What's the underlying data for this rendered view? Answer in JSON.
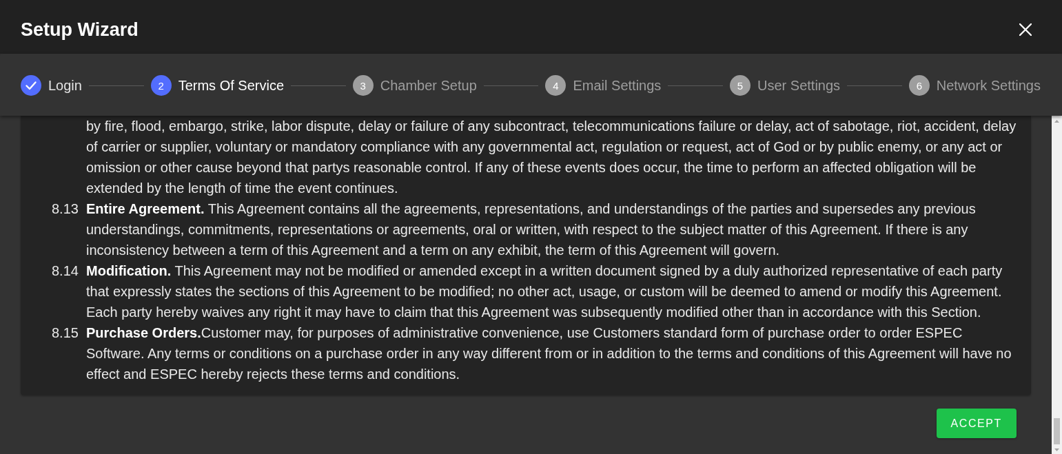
{
  "dialog": {
    "title": "Setup Wizard"
  },
  "steps": [
    {
      "kind": "done",
      "label": "Login",
      "selected": false
    },
    {
      "kind": "numbered",
      "number": "2",
      "label": "Terms Of Service",
      "selected": true
    },
    {
      "kind": "numbered",
      "number": "3",
      "label": "Chamber Setup",
      "selected": false
    },
    {
      "kind": "numbered",
      "number": "4",
      "label": "Email Settings",
      "selected": false
    },
    {
      "kind": "numbered",
      "number": "5",
      "label": "User Settings",
      "selected": false
    },
    {
      "kind": "numbered",
      "number": "6",
      "label": "Network Settings",
      "selected": false
    }
  ],
  "terms": [
    {
      "text": "by fire, flood, embargo, strike, labor dispute, delay or failure of any subcontract, telecommunications failure or delay, act of sabotage, riot, accident, delay of carrier or supplier, voluntary or mandatory compliance with any governmental act, regulation or request, act of God or by public enemy, or any act or omission or other cause beyond that partys reasonable control. If any of these events does occur, the time to perform an affected obligation will be extended by the length of time the event continues."
    },
    {
      "number": "8.13",
      "text": "**Entire Agreement.** This Agreement contains all the agreements, representations, and understandings of the parties and supersedes any previous understandings, commitments, representations or agreements, oral or written, with respect to the subject matter of this Agreement. If there is any inconsistency between a term of this Agreement and a term on any exhibit, the term of this Agreement will govern."
    },
    {
      "number": "8.14",
      "text": "**Modification.** This Agreement may not be modified or amended except in a written document signed by a duly authorized representative of each party that expressly states the sections of this Agreement to be modified; no other act, usage, or custom will be deemed to amend or modify this Agreement. Each party hereby waives any right it may have to claim that this Agreement was subsequently modified other than in accordance with this Section."
    },
    {
      "number": "8.15",
      "text": "**Purchase Orders.**Customer may, for purposes of administrative convenience, use Customers standard form of purchase order to order ESPEC Software. Any terms or conditions on a purchase order in any way different from or in addition to the terms and conditions of this Agreement will have no effect and ESPEC hereby rejects these terms and conditions."
    }
  ],
  "actions": {
    "accept": "ACCEPT"
  }
}
